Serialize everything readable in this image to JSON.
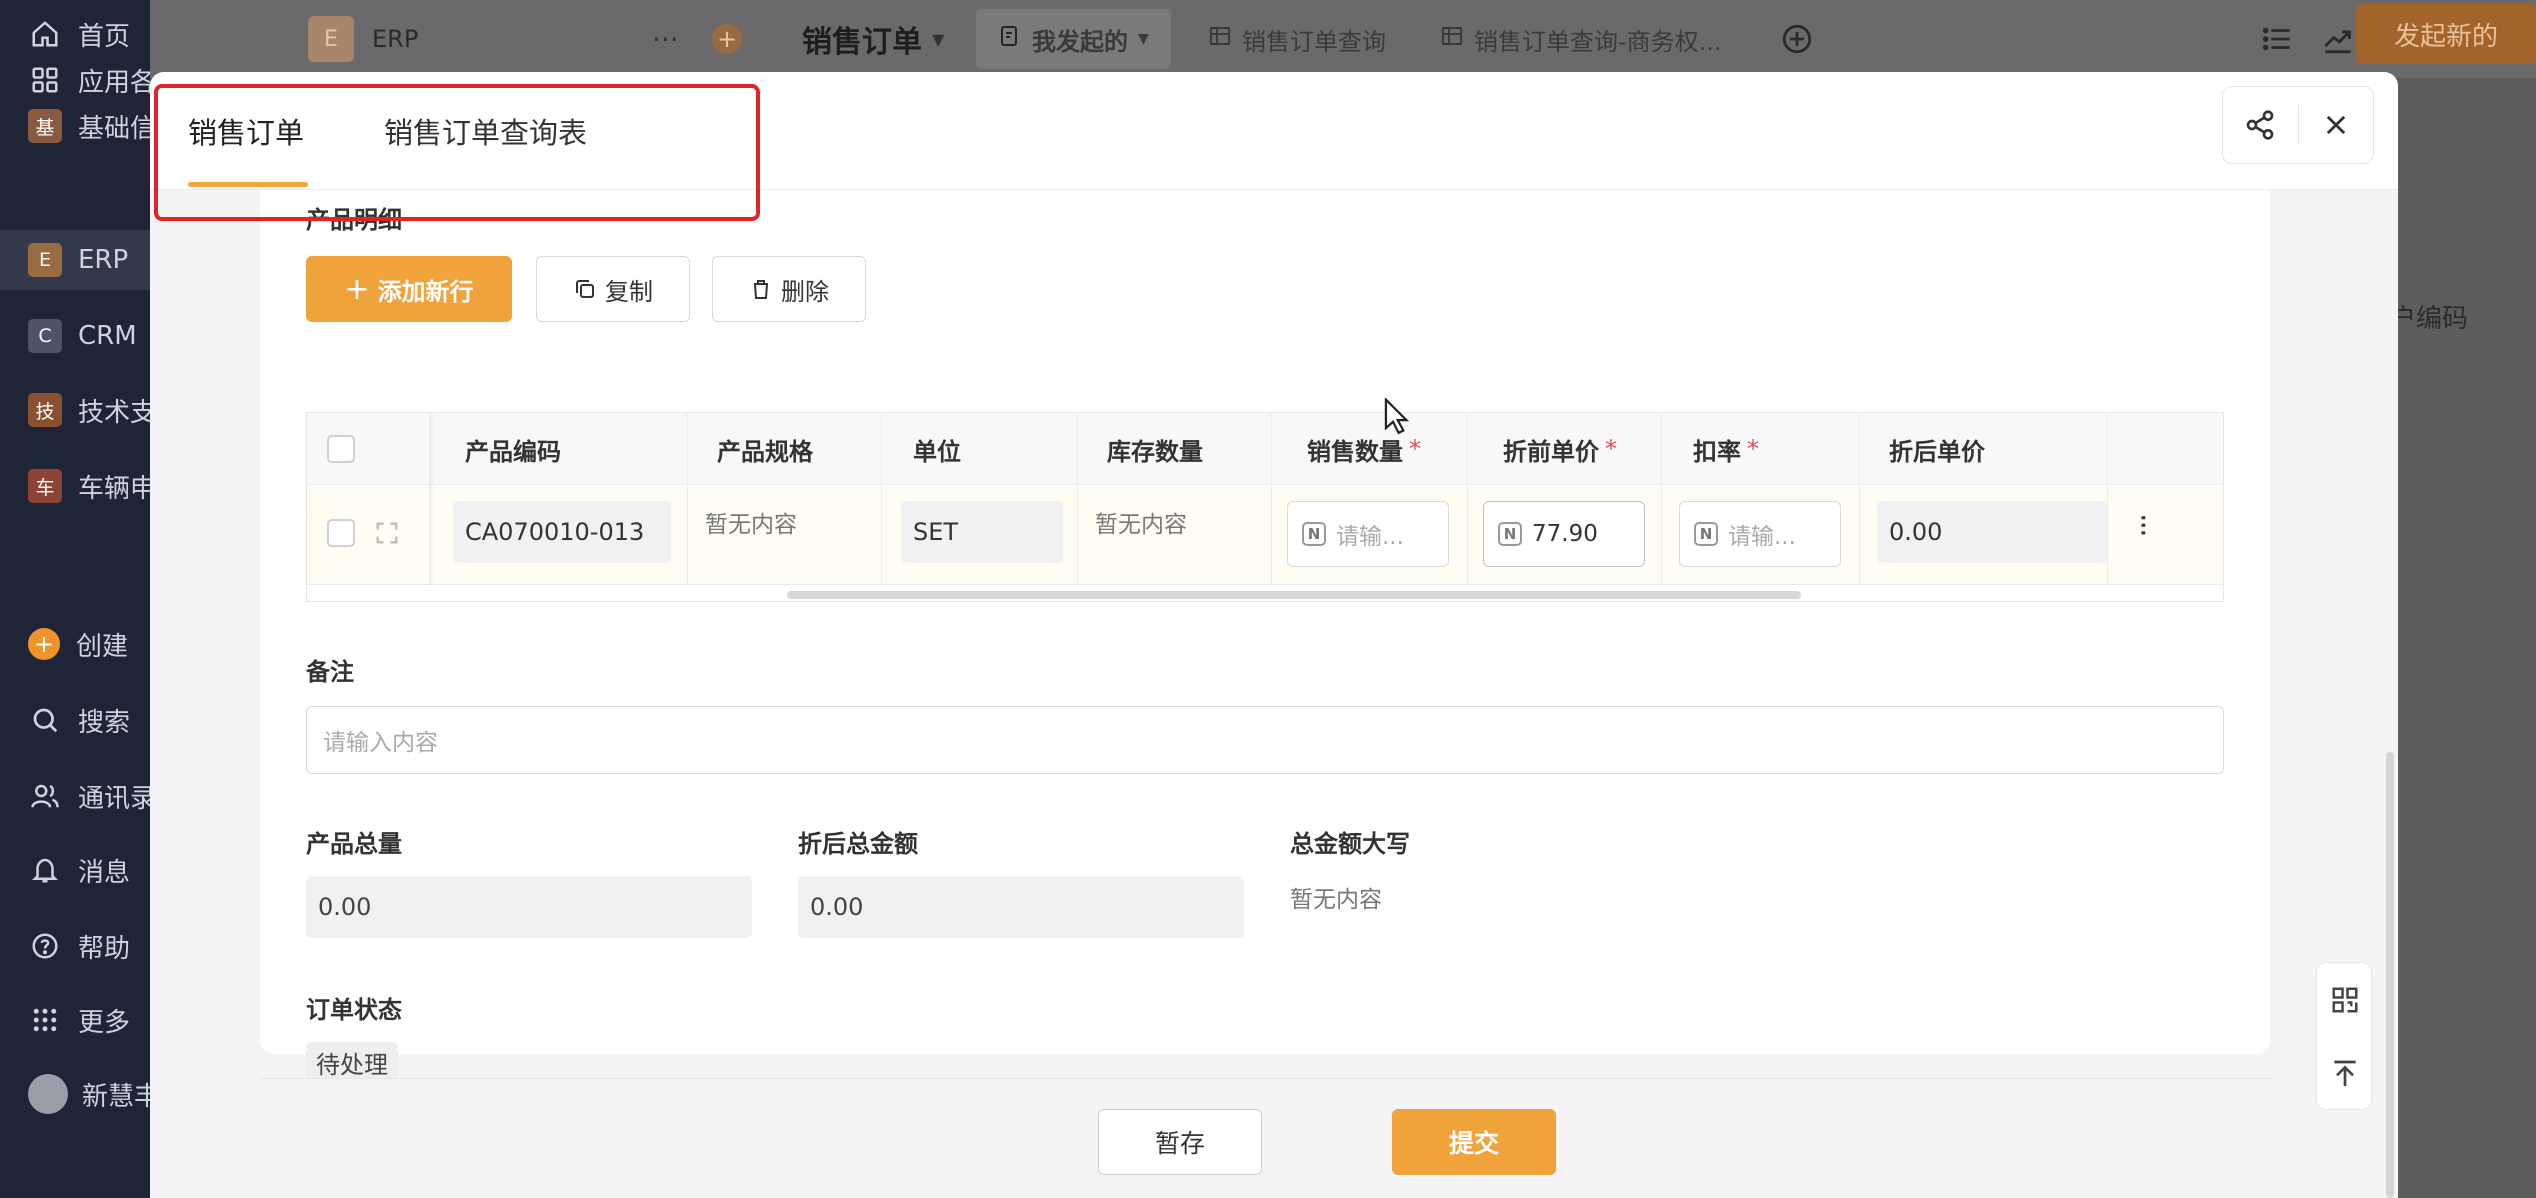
{
  "sidebar": {
    "items": [
      {
        "label": "首页",
        "icon": "home-icon"
      },
      {
        "label": "应用各",
        "icon": "apps-icon"
      },
      {
        "label": "基础信",
        "badge": "基",
        "badge_color": "#b0643b"
      },
      {
        "label": "ERP",
        "badge": "E",
        "badge_color": "#b27a4c"
      },
      {
        "label": "CRM",
        "badge": "C",
        "badge_color": "#4e5466"
      },
      {
        "label": "技术支",
        "badge": "技",
        "badge_color": "#a05a36"
      },
      {
        "label": "车辆申",
        "badge": "车",
        "badge_color": "#b0503a"
      }
    ],
    "bottom_items": [
      {
        "label": "创建",
        "icon": "plus-circle-icon"
      },
      {
        "label": "搜索",
        "icon": "search-icon"
      },
      {
        "label": "通讯录",
        "icon": "contacts-icon"
      },
      {
        "label": "消息",
        "icon": "bell-icon"
      },
      {
        "label": "帮助",
        "icon": "help-icon"
      },
      {
        "label": "更多",
        "icon": "grid-icon"
      },
      {
        "label": "新慧丰",
        "icon": "avatar"
      }
    ]
  },
  "topbar": {
    "app_badge": "E",
    "app_name": "ERP",
    "page_title": "销售订单",
    "tabs": [
      "我发起的",
      "销售订单查询",
      "销售订单查询-商务权..."
    ],
    "start_button": "发起新的",
    "bg_column_text": "户编码"
  },
  "modal": {
    "tabs": [
      {
        "label": "销售订单",
        "active": true
      },
      {
        "label": "销售订单查询表",
        "active": false
      }
    ],
    "section_title": "产品明细",
    "toolbar": {
      "add_row": "添加新行",
      "copy": "复制",
      "delete": "删除"
    },
    "table": {
      "headers": [
        {
          "label": "产品编码",
          "required": false
        },
        {
          "label": "产品规格",
          "required": false
        },
        {
          "label": "单位",
          "required": false
        },
        {
          "label": "库存数量",
          "required": false
        },
        {
          "label": "销售数量",
          "required": true
        },
        {
          "label": "折前单价",
          "required": true
        },
        {
          "label": "扣率",
          "required": true
        },
        {
          "label": "折后单价",
          "required": false
        }
      ],
      "row": {
        "product_code": "CA070010-013",
        "spec": "暂无内容",
        "unit": "SET",
        "stock": "暂无内容",
        "sales_qty_placeholder": "请输...",
        "unit_price": "77.90",
        "discount_placeholder": "请输...",
        "net_price": "0.00"
      },
      "required_mark": "*",
      "number_icon": "N"
    },
    "remark": {
      "label": "备注",
      "placeholder": "请输入内容"
    },
    "summary": {
      "total_qty_label": "产品总量",
      "total_qty": "0.00",
      "net_total_label": "折后总金额",
      "net_total": "0.00",
      "amount_upper_label": "总金额大写",
      "amount_upper": "暂无内容"
    },
    "status": {
      "label": "订单状态",
      "value": "待处理"
    },
    "footer": {
      "save": "暂存",
      "submit": "提交"
    }
  },
  "colors": {
    "accent": "#f0a23b",
    "highlight_border": "#e0252a",
    "required": "#e34d4d"
  }
}
